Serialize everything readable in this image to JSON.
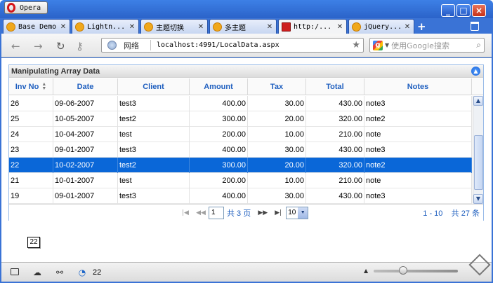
{
  "browser": {
    "menu_label": "Opera",
    "window_buttons": [
      "_",
      "□",
      "×"
    ]
  },
  "tabs": [
    {
      "label": "Base Demo",
      "active": false,
      "icon": "jquery-favicon"
    },
    {
      "label": "Lightn...",
      "active": false,
      "icon": "jquery-favicon"
    },
    {
      "label": "主题切换",
      "active": false,
      "icon": "jquery-favicon"
    },
    {
      "label": "多主题",
      "active": false,
      "icon": "jquery-favicon"
    },
    {
      "label": "http:/...",
      "active": true,
      "icon": "page-favicon"
    },
    {
      "label": "jQuery...",
      "active": false,
      "icon": "jquery-favicon"
    }
  ],
  "toolbar": {
    "address_label": "网络",
    "url": "localhost:4991/LocalData.aspx",
    "search_placeholder": "使用Google搜索",
    "search_engine_letter": "g"
  },
  "panel": {
    "title": "Manipulating Array Data"
  },
  "grid": {
    "columns": [
      "Inv No",
      "Date",
      "Client",
      "Amount",
      "Tax",
      "Total",
      "Notes"
    ],
    "sort_indicator": "▲▼",
    "rows": [
      [
        "26",
        "09-06-2007",
        "test3",
        "400.00",
        "30.00",
        "430.00",
        "note3"
      ],
      [
        "25",
        "10-05-2007",
        "test2",
        "300.00",
        "20.00",
        "320.00",
        "note2"
      ],
      [
        "24",
        "10-04-2007",
        "test",
        "200.00",
        "10.00",
        "210.00",
        "note"
      ],
      [
        "23",
        "09-01-2007",
        "test3",
        "400.00",
        "30.00",
        "430.00",
        "note3"
      ],
      [
        "22",
        "10-02-2007",
        "test2",
        "300.00",
        "20.00",
        "320.00",
        "note2"
      ],
      [
        "21",
        "10-01-2007",
        "test",
        "200.00",
        "10.00",
        "210.00",
        "note"
      ],
      [
        "19",
        "09-01-2007",
        "test3",
        "400.00",
        "30.00",
        "430.00",
        "note3"
      ]
    ],
    "selected_row": 4,
    "tooltip": "22"
  },
  "pager": {
    "first": "|◀",
    "prev": "◀◀",
    "page_value": "1",
    "total_pages_text": "共 3 页",
    "next": "▶▶",
    "last": "▶|",
    "page_size": "10",
    "range_text": "1 - 10",
    "total_text": "共 27 条"
  },
  "status_bar": {
    "count": "22",
    "zoom_level_fraction": 0.35
  },
  "colors": {
    "accent": "#1f5fbf",
    "selected_row": "#0a67d8",
    "frame": "#3a73d6"
  }
}
